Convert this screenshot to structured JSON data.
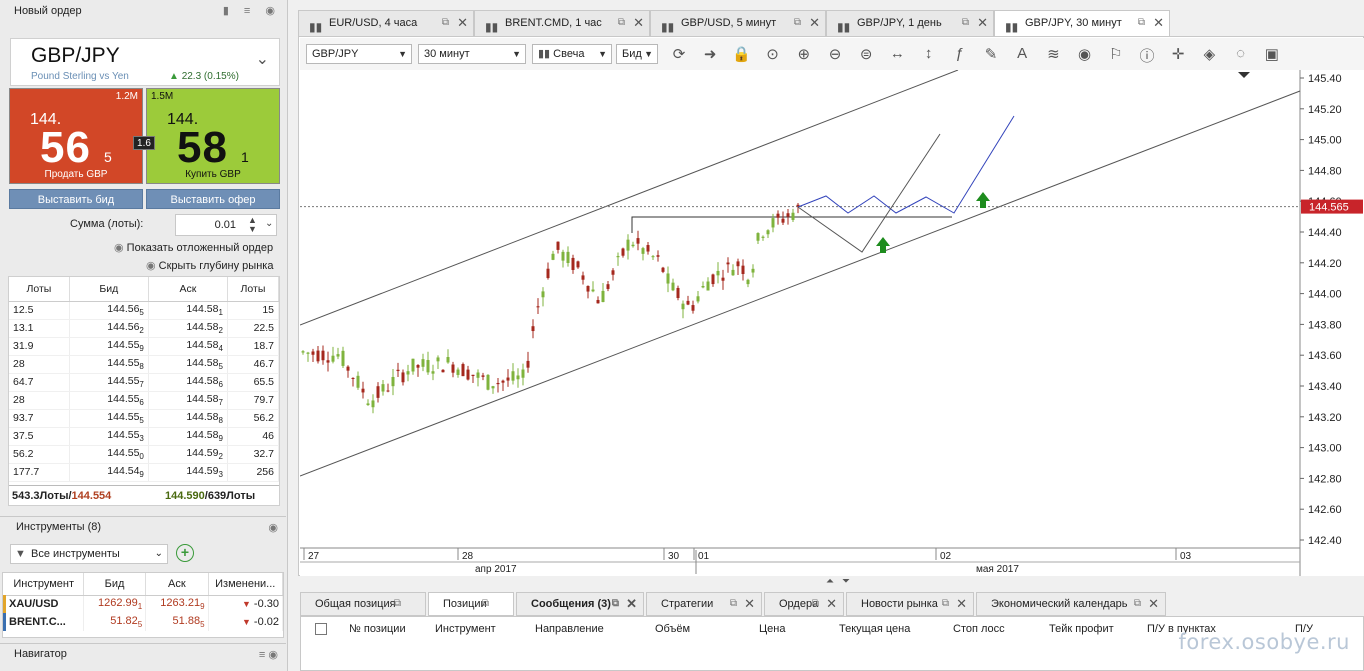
{
  "order_panel": {
    "title": "Новый ордер",
    "instrument": "GBP/JPY",
    "instrument_desc": "Pound Sterling vs Yen",
    "change": "22.3 (0.15%)",
    "sell": {
      "volume": "1.2M",
      "prefix": "144.",
      "big": "56",
      "small": "5",
      "label": "Продать GBP"
    },
    "buy": {
      "volume": "1.5M",
      "prefix": "144.",
      "big": "58",
      "small": "1",
      "label": "Купить GBP"
    },
    "spread": "1.6",
    "bid_button": "Выставить бид",
    "offer_button": "Выставить офер",
    "amount_label": "Сумма (лоты):",
    "amount_value": "0.01",
    "show_pending": "Показать отложенный ордер",
    "hide_depth": "Скрыть глубину рынка"
  },
  "depth": {
    "headers": [
      "Лоты",
      "Бид",
      "Аск",
      "Лоты"
    ],
    "rows": [
      [
        "12.5",
        "144.56",
        "5",
        "144.58",
        "1",
        "15"
      ],
      [
        "13.1",
        "144.56",
        "2",
        "144.58",
        "2",
        "22.5"
      ],
      [
        "31.9",
        "144.55",
        "9",
        "144.58",
        "4",
        "18.7"
      ],
      [
        "28",
        "144.55",
        "8",
        "144.58",
        "5",
        "46.7"
      ],
      [
        "64.7",
        "144.55",
        "7",
        "144.58",
        "6",
        "65.5"
      ],
      [
        "28",
        "144.55",
        "6",
        "144.58",
        "7",
        "79.7"
      ],
      [
        "93.7",
        "144.55",
        "5",
        "144.58",
        "8",
        "56.2"
      ],
      [
        "37.5",
        "144.55",
        "3",
        "144.58",
        "9",
        "46"
      ],
      [
        "56.2",
        "144.55",
        "0",
        "144.59",
        "2",
        "32.7"
      ],
      [
        "177.7",
        "144.54",
        "9",
        "144.59",
        "3",
        "256"
      ]
    ],
    "footer_left_lots": "543.3Лоты/",
    "footer_left_price": "144.554",
    "footer_right_price": "144.590",
    "footer_right_lots": "/639Лоты"
  },
  "instruments": {
    "title": "Инструменты (8)",
    "filter": "Все инструменты",
    "headers": [
      "Инструмент",
      "Бид",
      "Аск",
      "Изменени..."
    ],
    "rows": [
      {
        "name": "XAU/USD",
        "bid": "1262.99",
        "bid_s": "1",
        "ask": "1263.21",
        "ask_s": "9",
        "change": "-0.30"
      },
      {
        "name": "BRENT.C...",
        "bid": "51.82",
        "bid_s": "5",
        "ask": "51.88",
        "ask_s": "5",
        "change": "-0.02"
      }
    ]
  },
  "navigator": {
    "title": "Навигатор"
  },
  "chart_tabs": [
    {
      "label": "EUR/USD, 4 часа"
    },
    {
      "label": "BRENT.CMD, 1 час"
    },
    {
      "label": "GBP/USD, 5 минут"
    },
    {
      "label": "GBP/JPY, 1 день"
    },
    {
      "label": "GBP/JPY, 30 минут"
    }
  ],
  "toolbar": {
    "instrument": "GBP/JPY",
    "period": "30 минут",
    "type": "Свеча",
    "side": "Бид"
  },
  "chart": {
    "price_labels": [
      "145.40",
      "145.20",
      "145.00",
      "144.80",
      "144.60",
      "144.40",
      "144.20",
      "144.00",
      "143.80",
      "143.60",
      "143.40",
      "143.20",
      "143.00",
      "142.80",
      "142.60",
      "142.40"
    ],
    "current_price": "144.565",
    "date_labels": [
      "27",
      "28",
      "30",
      "01",
      "02",
      "03"
    ],
    "month_labels": [
      "апр 2017",
      "мая 2017"
    ]
  },
  "bottom_tabs": [
    {
      "label": "Общая позиция"
    },
    {
      "label": "Позиции"
    },
    {
      "label": "Сообщения (3)"
    },
    {
      "label": "Стратегии"
    },
    {
      "label": "Ордера"
    },
    {
      "label": "Новости рынка"
    },
    {
      "label": "Экономический календарь"
    }
  ],
  "positions_headers": [
    "№ позиции",
    "Инструмент",
    "Направление",
    "Объём",
    "Цена",
    "Текущая цена",
    "Стоп лосс",
    "Тейк профит",
    "П/У в пунктах",
    "П/У"
  ],
  "watermark": "forex.osobye.ru",
  "colors": {
    "sell": "#d24727",
    "buy": "#9ccb3a",
    "bull_candle": "#7fb33d",
    "bear_candle": "#a5281e",
    "price_tag": "#c8242a"
  }
}
